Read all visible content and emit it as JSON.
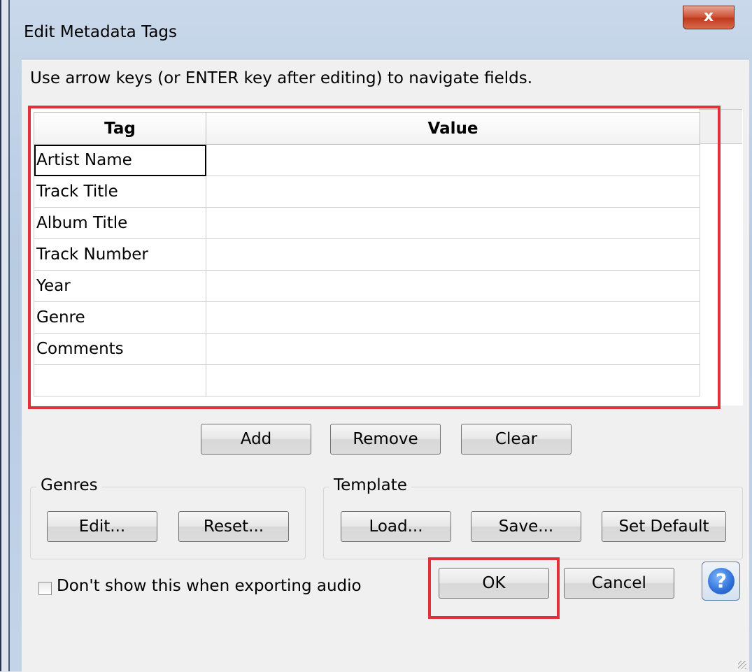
{
  "window": {
    "title": "Edit Metadata Tags",
    "close_glyph": "x"
  },
  "instructions": "Use arrow keys (or ENTER key after editing) to navigate fields.",
  "grid": {
    "columns": [
      "Tag",
      "Value"
    ],
    "rows": [
      {
        "tag": "Artist Name",
        "value": ""
      },
      {
        "tag": "Track Title",
        "value": ""
      },
      {
        "tag": "Album Title",
        "value": ""
      },
      {
        "tag": "Track Number",
        "value": ""
      },
      {
        "tag": "Year",
        "value": ""
      },
      {
        "tag": "Genre",
        "value": ""
      },
      {
        "tag": "Comments",
        "value": ""
      },
      {
        "tag": "",
        "value": ""
      }
    ]
  },
  "row_buttons": {
    "add": "Add",
    "remove": "Remove",
    "clear": "Clear"
  },
  "genres": {
    "label": "Genres",
    "edit": "Edit...",
    "reset": "Reset..."
  },
  "template": {
    "label": "Template",
    "load": "Load...",
    "save": "Save...",
    "set_default": "Set Default"
  },
  "checkbox": {
    "label": "Don't show this when exporting audio",
    "checked": false
  },
  "dialog_buttons": {
    "ok": "OK",
    "cancel": "Cancel",
    "help_glyph": "?"
  },
  "colors": {
    "highlight": "#e0303a",
    "close_button": "#c9452a",
    "help_icon": "#2f6fd6"
  }
}
